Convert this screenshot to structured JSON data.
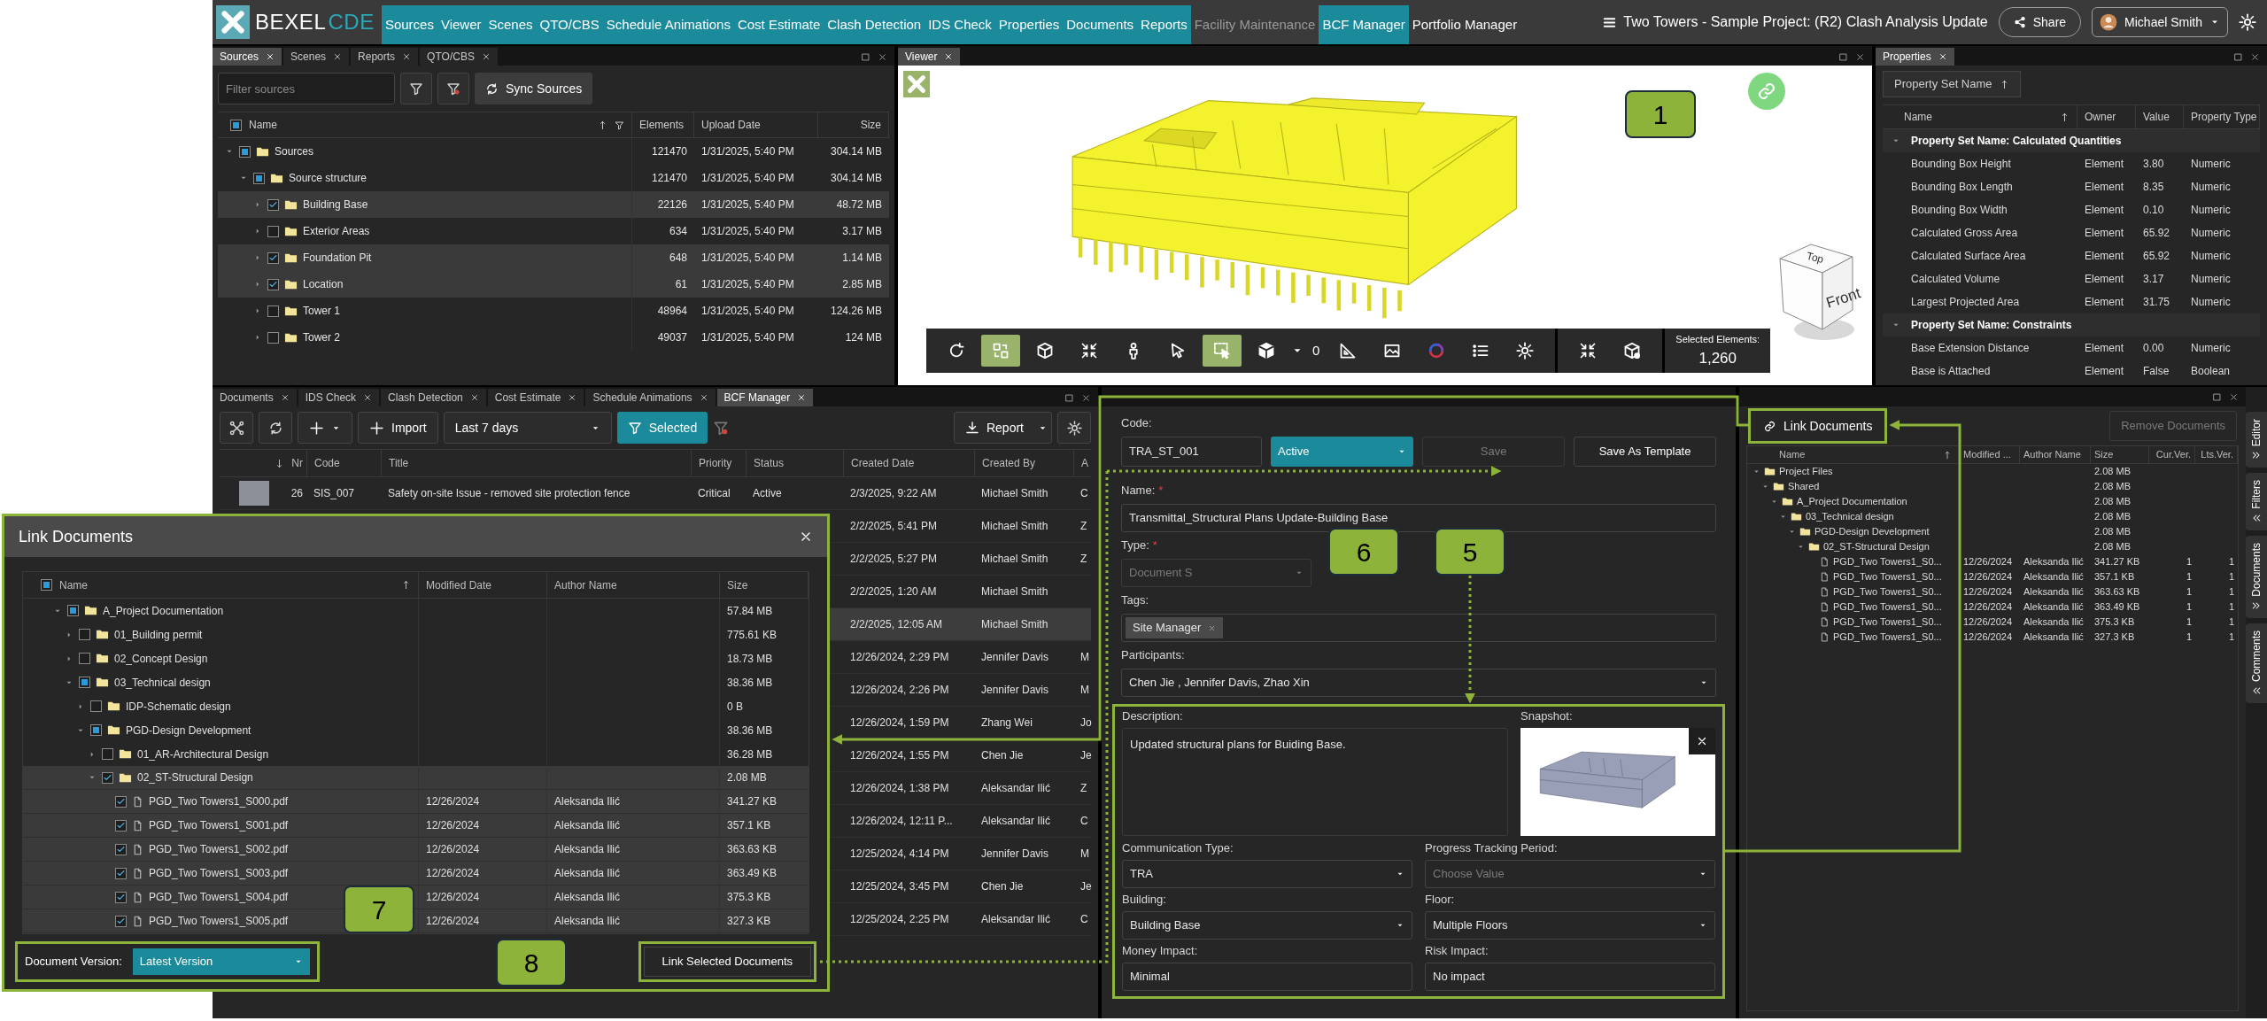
{
  "app_bar": {
    "logo_text": "BEXEL",
    "logo_accent": "CDE",
    "menu": [
      {
        "label": "Sources",
        "open": true,
        "disabled": false
      },
      {
        "label": "Viewer",
        "open": true,
        "disabled": false
      },
      {
        "label": "Scenes",
        "open": true,
        "disabled": false
      },
      {
        "label": "QTO/CBS",
        "open": true,
        "disabled": false
      },
      {
        "label": "Schedule Animations",
        "open": true,
        "disabled": false
      },
      {
        "label": "Cost Estimate",
        "open": true,
        "disabled": false
      },
      {
        "label": "Clash Detection",
        "open": true,
        "disabled": false
      },
      {
        "label": "IDS Check",
        "open": true,
        "disabled": false
      },
      {
        "label": "Properties",
        "open": true,
        "disabled": false
      },
      {
        "label": "Documents",
        "open": true,
        "disabled": false
      },
      {
        "label": "Reports",
        "open": true,
        "disabled": false
      },
      {
        "label": "Facility Maintenance",
        "open": false,
        "disabled": true
      },
      {
        "label": "BCF Manager",
        "open": true,
        "disabled": false
      },
      {
        "label": "Portfolio Manager",
        "open": false,
        "disabled": false
      }
    ],
    "project_title": "Two Towers - Sample Project: (R2) Clash Analysis Update",
    "share_button": "Share",
    "user_name": "Michael Smith"
  },
  "sources_panel": {
    "tabs": [
      {
        "label": "Sources",
        "selected": true
      },
      {
        "label": "Scenes",
        "selected": false
      },
      {
        "label": "Reports",
        "selected": false
      },
      {
        "label": "QTO/CBS",
        "selected": false
      }
    ],
    "filter": {
      "placeholder": "Filter sources"
    },
    "sync_button": "Sync Sources",
    "header_check": {
      "checked": false,
      "partial": true
    },
    "columns": [
      "Name",
      "Elements",
      "Upload Date",
      "Size"
    ],
    "tree": [
      {
        "name": "Sources",
        "checked": false,
        "partial": true,
        "expanded": true,
        "elements": "121470",
        "upload_date": "1/31/2025, 5:40 PM",
        "size": "304.14 MB",
        "children": [
          {
            "name": "Source structure",
            "checked": false,
            "partial": true,
            "expanded": true,
            "elements": "121470",
            "upload_date": "1/31/2025, 5:40 PM",
            "size": "304.14 MB",
            "children": [
              {
                "name": "Building Base",
                "checked": true,
                "partial": false,
                "expanded": false,
                "elements": "22126",
                "upload_date": "1/31/2025, 5:40 PM",
                "size": "48.72 MB"
              },
              {
                "name": "Exterior Areas",
                "checked": false,
                "partial": false,
                "expanded": false,
                "elements": "634",
                "upload_date": "1/31/2025, 5:40 PM",
                "size": "3.17 MB"
              },
              {
                "name": "Foundation Pit",
                "checked": true,
                "partial": false,
                "expanded": false,
                "elements": "648",
                "upload_date": "1/31/2025, 5:40 PM",
                "size": "1.14 MB"
              },
              {
                "name": "Location",
                "checked": true,
                "partial": false,
                "expanded": false,
                "elements": "61",
                "upload_date": "1/31/2025, 5:40 PM",
                "size": "2.85 MB"
              },
              {
                "name": "Tower 1",
                "checked": false,
                "partial": false,
                "expanded": false,
                "elements": "48964",
                "upload_date": "1/31/2025, 5:40 PM",
                "size": "124.26 MB"
              },
              {
                "name": "Tower 2",
                "checked": false,
                "partial": false,
                "expanded": false,
                "elements": "49037",
                "upload_date": "1/31/2025, 5:40 PM",
                "size": "124 MB"
              }
            ]
          }
        ]
      }
    ]
  },
  "viewer": {
    "tab": {
      "label": "Viewer",
      "selected": true
    },
    "cube": {
      "top": "Top",
      "front": "Front"
    },
    "tools": [
      {
        "kind": "orbit",
        "active": false
      },
      {
        "kind": "swap",
        "active": true
      },
      {
        "kind": "box",
        "active": false
      },
      {
        "kind": "collapse",
        "active": false
      },
      {
        "kind": "person",
        "active": false
      },
      {
        "kind": "pointer",
        "active": false
      },
      {
        "kind": "select-box",
        "active": true
      },
      {
        "kind": "solid-cube",
        "active": false,
        "value": "0"
      },
      {
        "kind": "measure",
        "active": false
      },
      {
        "kind": "image",
        "active": false
      },
      {
        "kind": "color-wheel",
        "active": false
      },
      {
        "kind": "list",
        "active": false
      },
      {
        "kind": "gear",
        "active": false
      }
    ],
    "extra_tools": [
      {
        "kind": "collapse",
        "active": false
      },
      {
        "kind": "cube-eye",
        "active": false
      }
    ],
    "selected_label": "Selected Elements:",
    "selected_value": "1,260"
  },
  "properties_panel": {
    "tab": {
      "label": "Properties",
      "selected": true
    },
    "group_chip": "Property Set Name",
    "columns": [
      "Name",
      "Owner",
      "Value",
      "Property Type"
    ],
    "groups": [
      {
        "title": "Property Set Name: Calculated Quantities",
        "expanded": true,
        "rows": [
          [
            "Bounding Box Height",
            "Element",
            "3.80",
            "Numeric"
          ],
          [
            "Bounding Box Length",
            "Element",
            "8.35",
            "Numeric"
          ],
          [
            "Bounding Box Width",
            "Element",
            "0.10",
            "Numeric"
          ],
          [
            "Calculated Gross Area",
            "Element",
            "65.92",
            "Numeric"
          ],
          [
            "Calculated Surface Area",
            "Element",
            "65.92",
            "Numeric"
          ],
          [
            "Calculated Volume",
            "Element",
            "3.17",
            "Numeric"
          ],
          [
            "Largest Projected Area",
            "Element",
            "31.75",
            "Numeric"
          ]
        ]
      },
      {
        "title": "Property Set Name: Constraints",
        "expanded": true,
        "rows": [
          [
            "Base Extension Distance",
            "Element",
            "0.00",
            "Numeric"
          ],
          [
            "Base is Attached",
            "Element",
            "False",
            "Boolean"
          ]
        ]
      }
    ]
  },
  "bcf_panel": {
    "tabs": [
      {
        "label": "Documents",
        "selected": false
      },
      {
        "label": "IDS Check",
        "selected": false
      },
      {
        "label": "Clash Detection",
        "selected": false
      },
      {
        "label": "Cost Estimate",
        "selected": false
      },
      {
        "label": "Schedule Animations",
        "selected": false
      },
      {
        "label": "BCF Manager",
        "selected": true
      }
    ],
    "import_button": "Import",
    "period": "Last 7 days",
    "filter_button": "Selected",
    "report_button": "Report",
    "columns": [
      "Nr",
      "Code",
      "Title",
      "Priority",
      "Status",
      "Created Date",
      "Created By",
      "A"
    ],
    "rows": [
      {
        "selected": false,
        "thumbnail": true,
        "nr": "26",
        "code": "SIS_007",
        "title": "Safety on-site Issue - removed site protection fence",
        "priority": "Critical",
        "status": "Active",
        "created_date": "2/3/2025, 9:22 AM",
        "created_by": "Michael Smith",
        "column_a": "C"
      },
      {
        "selected": false,
        "created_date": "2/2/2025, 5:41 PM",
        "created_by": "Michael Smith",
        "column_a": "Z"
      },
      {
        "selected": false,
        "created_date": "2/2/2025, 5:27 PM",
        "created_by": "Michael Smith",
        "column_a": "Z"
      },
      {
        "selected": false,
        "created_date": "2/2/2025, 1:20 AM",
        "created_by": "Michael Smith"
      },
      {
        "selected": true,
        "created_date": "2/2/2025, 12:05 AM",
        "created_by": "Michael Smith"
      },
      {
        "selected": false,
        "created_date": "12/26/2024, 2:29 PM",
        "created_by": "Jennifer Davis",
        "column_a": "M"
      },
      {
        "selected": false,
        "created_date": "12/26/2024, 2:26 PM",
        "created_by": "Jennifer Davis",
        "column_a": "M"
      },
      {
        "selected": false,
        "created_date": "12/26/2024, 1:59 PM",
        "created_by": "Zhang Wei",
        "column_a": "Jo"
      },
      {
        "selected": false,
        "created_date": "12/26/2024, 1:55 PM",
        "created_by": "Chen Jie",
        "column_a": "Je"
      },
      {
        "selected": false,
        "created_date": "12/26/2024, 1:38 PM",
        "created_by": "Aleksandar Ilić",
        "column_a": "Z"
      },
      {
        "selected": false,
        "created_date": "12/26/2024, 12:11 P...",
        "created_by": "Aleksandar Ilić",
        "column_a": "C"
      },
      {
        "selected": false,
        "created_date": "12/25/2024, 4:14 PM",
        "created_by": "Jennifer Davis",
        "column_a": "M"
      },
      {
        "selected": false,
        "created_date": "12/25/2024, 3:45 PM",
        "created_by": "Chen Jie",
        "column_a": "Je"
      },
      {
        "selected": false,
        "created_date": "12/25/2024, 2:25 PM",
        "created_by": "Aleksandar Ilić",
        "column_a": "C"
      }
    ]
  },
  "bcf_form": {
    "code": {
      "label": "Code:",
      "value": "TRA_ST_001"
    },
    "status": "Active",
    "save_button": {
      "label": "Save",
      "disabled": true
    },
    "template_button": "Save As Template",
    "name": {
      "label": "Name:",
      "required_mark": "*",
      "value": "Transmittal_Structural Plans Update-Building Base"
    },
    "type": {
      "label": "Type:",
      "required_mark": "*",
      "value": "Document S",
      "disabled": true
    },
    "tags": {
      "label": "Tags:",
      "items": [
        "Site Manager"
      ]
    },
    "participants": {
      "label": "Participants:",
      "value": "Chen Jie , Jennifer Davis, Zhao Xin"
    },
    "description": {
      "label": "Description:",
      "value": "Updated structural plans for Buiding Base."
    },
    "snapshot": {
      "label": "Snapshot:"
    },
    "fields": [
      {
        "kind": "dropdown",
        "label": "Communication Type:",
        "value": "TRA"
      },
      {
        "kind": "dropdown",
        "label": "Progress Tracking Period:",
        "placeholder": "Choose Value"
      },
      {
        "kind": "dropdown",
        "label": "Building:",
        "value": "Building Base"
      },
      {
        "kind": "dropdown",
        "label": "Floor:",
        "value": "Multiple Floors"
      },
      {
        "kind": "text",
        "label": "Money Impact:",
        "value": "Minimal"
      },
      {
        "kind": "text",
        "label": "Risk Impact:",
        "value": "No impact"
      }
    ]
  },
  "documents_panel": {
    "link_button": "Link Documents",
    "remove_button": {
      "label": "Remove Documents",
      "disabled": true
    },
    "columns": [
      "Name",
      "Modified ...",
      "Author Name",
      "Size",
      "Cur.Ver.",
      "Lts.Ver."
    ],
    "tree": [
      {
        "kind": "folder",
        "name": "Project Files",
        "expanded": true,
        "size": "2.08 MB",
        "children": [
          {
            "kind": "folder",
            "name": "Shared",
            "expanded": true,
            "size": "2.08 MB",
            "children": [
              {
                "kind": "folder",
                "name": "A_Project Documentation",
                "expanded": true,
                "size": "2.08 MB",
                "children": [
                  {
                    "kind": "folder",
                    "name": "03_Technical design",
                    "expanded": true,
                    "size": "2.08 MB",
                    "children": [
                      {
                        "kind": "folder",
                        "name": "PGD-Design Development",
                        "expanded": true,
                        "size": "2.08 MB",
                        "children": [
                          {
                            "kind": "folder",
                            "name": "02_ST-Structural Design",
                            "expanded": true,
                            "size": "2.08 MB",
                            "children": [
                              {
                                "kind": "file",
                                "name": "PGD_Two Towers1_S0...",
                                "modified": "12/26/2024",
                                "author": "Aleksanda Ilić",
                                "size": "341.27 KB",
                                "cur": "1",
                                "lts": "1"
                              },
                              {
                                "kind": "file",
                                "name": "PGD_Two Towers1_S0...",
                                "modified": "12/26/2024",
                                "author": "Aleksanda Ilić",
                                "size": "357.1 KB",
                                "cur": "1",
                                "lts": "1"
                              },
                              {
                                "kind": "file",
                                "name": "PGD_Two Towers1_S0...",
                                "modified": "12/26/2024",
                                "author": "Aleksanda Ilić",
                                "size": "363.63 KB",
                                "cur": "1",
                                "lts": "1"
                              },
                              {
                                "kind": "file",
                                "name": "PGD_Two Towers1_S0...",
                                "modified": "12/26/2024",
                                "author": "Aleksanda Ilić",
                                "size": "363.49 KB",
                                "cur": "1",
                                "lts": "1"
                              },
                              {
                                "kind": "file",
                                "name": "PGD_Two Towers1_S0...",
                                "modified": "12/26/2024",
                                "author": "Aleksanda Ilić",
                                "size": "375.3 KB",
                                "cur": "1",
                                "lts": "1"
                              },
                              {
                                "kind": "file",
                                "name": "PGD_Two Towers1_S0...",
                                "modified": "12/26/2024",
                                "author": "Aleksanda Ilić",
                                "size": "327.3 KB",
                                "cur": "1",
                                "lts": "1"
                              }
                            ]
                          }
                        ]
                      }
                    ]
                  }
                ]
              }
            ]
          }
        ]
      }
    ],
    "side_tabs": [
      {
        "label": "Editor",
        "chevron_right": true
      },
      {
        "label": "Filters",
        "chevron_right": false
      },
      {
        "label": "Documents",
        "chevron_right": true
      },
      {
        "label": "Comments",
        "chevron_right": false
      }
    ]
  },
  "link_dialog": {
    "title": "Link Documents",
    "header_check": {
      "checked": false,
      "partial": true
    },
    "columns": [
      "Name",
      "Modified Date",
      "Author Name",
      "Size"
    ],
    "tree": [
      {
        "kind": "folder",
        "name": "A_Project Documentation",
        "checked": false,
        "partial": true,
        "expanded": true,
        "size": "57.84 MB",
        "children": [
          {
            "kind": "folder",
            "name": "01_Building permit",
            "checked": false,
            "partial": false,
            "expanded": false,
            "size": "775.61 KB"
          },
          {
            "kind": "folder",
            "name": "02_Concept Design",
            "checked": false,
            "partial": false,
            "expanded": false,
            "size": "18.73 MB"
          },
          {
            "kind": "folder",
            "name": "03_Technical design",
            "checked": false,
            "partial": true,
            "expanded": true,
            "size": "38.36 MB",
            "children": [
              {
                "kind": "folder",
                "name": "IDP-Schematic design",
                "checked": false,
                "partial": false,
                "expanded": false,
                "size": "0 B"
              },
              {
                "kind": "folder",
                "name": "PGD-Design Development",
                "checked": false,
                "partial": true,
                "expanded": true,
                "size": "38.36 MB",
                "children": [
                  {
                    "kind": "folder",
                    "name": "01_AR-Architectural Design",
                    "checked": false,
                    "partial": false,
                    "expanded": false,
                    "size": "36.28 MB"
                  },
                  {
                    "kind": "folder",
                    "name": "02_ST-Structural Design",
                    "checked": true,
                    "partial": false,
                    "expanded": true,
                    "size": "2.08 MB",
                    "children": [
                      {
                        "kind": "file",
                        "name": "PGD_Two Towers1_S000.pdf",
                        "checked": true,
                        "partial": false,
                        "modified": "12/26/2024",
                        "author": "Aleksanda Ilić",
                        "size": "341.27 KB"
                      },
                      {
                        "kind": "file",
                        "name": "PGD_Two Towers1_S001.pdf",
                        "checked": true,
                        "partial": false,
                        "modified": "12/26/2024",
                        "author": "Aleksanda Ilić",
                        "size": "357.1 KB"
                      },
                      {
                        "kind": "file",
                        "name": "PGD_Two Towers1_S002.pdf",
                        "checked": true,
                        "partial": false,
                        "modified": "12/26/2024",
                        "author": "Aleksanda Ilić",
                        "size": "363.63 KB"
                      },
                      {
                        "kind": "file",
                        "name": "PGD_Two Towers1_S003.pdf",
                        "checked": true,
                        "partial": false,
                        "modified": "12/26/2024",
                        "author": "Aleksanda Ilić",
                        "size": "363.49 KB"
                      },
                      {
                        "kind": "file",
                        "name": "PGD_Two Towers1_S004.pdf",
                        "checked": true,
                        "partial": false,
                        "modified": "12/26/2024",
                        "author": "Aleksanda Ilić",
                        "size": "375.3 KB"
                      },
                      {
                        "kind": "file",
                        "name": "PGD_Two Towers1_S005.pdf",
                        "checked": true,
                        "partial": false,
                        "modified": "12/26/2024",
                        "author": "Aleksanda Ilić",
                        "size": "327.3 KB"
                      }
                    ]
                  }
                ]
              }
            ]
          }
        ]
      }
    ],
    "version_label": "Document Version:",
    "version": "Latest Version",
    "link_button": "Link Selected Documents"
  },
  "callouts": [
    {
      "label": "1"
    },
    {
      "label": "5"
    },
    {
      "label": "6"
    },
    {
      "label": "7"
    },
    {
      "label": "8"
    }
  ]
}
